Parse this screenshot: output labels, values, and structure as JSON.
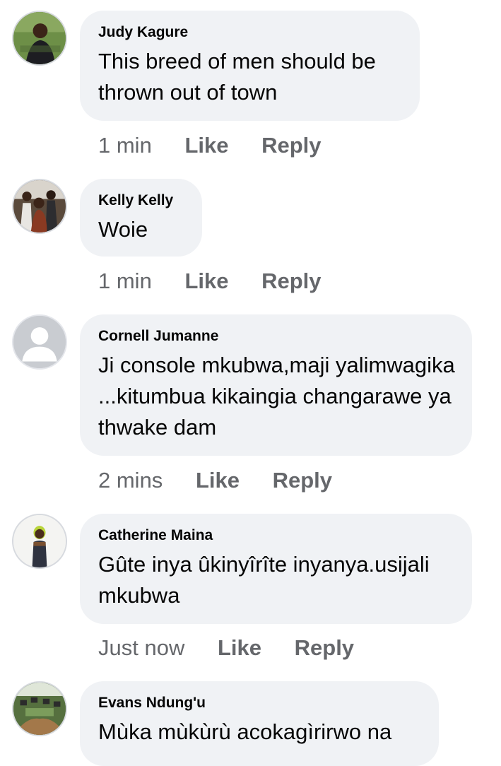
{
  "comments": [
    {
      "author": "Judy Kagure",
      "text": "This breed of men should be thrown out of town",
      "time": "1 min",
      "like_label": "Like",
      "reply_label": "Reply",
      "avatar": "profile-photo"
    },
    {
      "author": "Kelly Kelly",
      "text": "Woie",
      "time": "1 min",
      "like_label": "Like",
      "reply_label": "Reply",
      "avatar": "profile-photo"
    },
    {
      "author": "Cornell Jumanne",
      "text": "Ji console mkubwa,maji yalimwagika ...kitumbua kikaingia changarawe ya thwake dam",
      "time": "2 mins",
      "like_label": "Like",
      "reply_label": "Reply",
      "avatar": "default-user-icon"
    },
    {
      "author": "Catherine Maina",
      "text": "Gûte inya ûkinyîrîte inyanya.usijali mkubwa",
      "time": "Just now",
      "like_label": "Like",
      "reply_label": "Reply",
      "avatar": "profile-photo"
    },
    {
      "author": "Evans Ndung'u",
      "text": "Mùka mùkùrù acokagìrirwo na",
      "avatar": "profile-photo"
    }
  ],
  "colors": {
    "bubble_bg": "#f0f2f5",
    "text": "#050505",
    "secondary_text": "#65676b"
  }
}
